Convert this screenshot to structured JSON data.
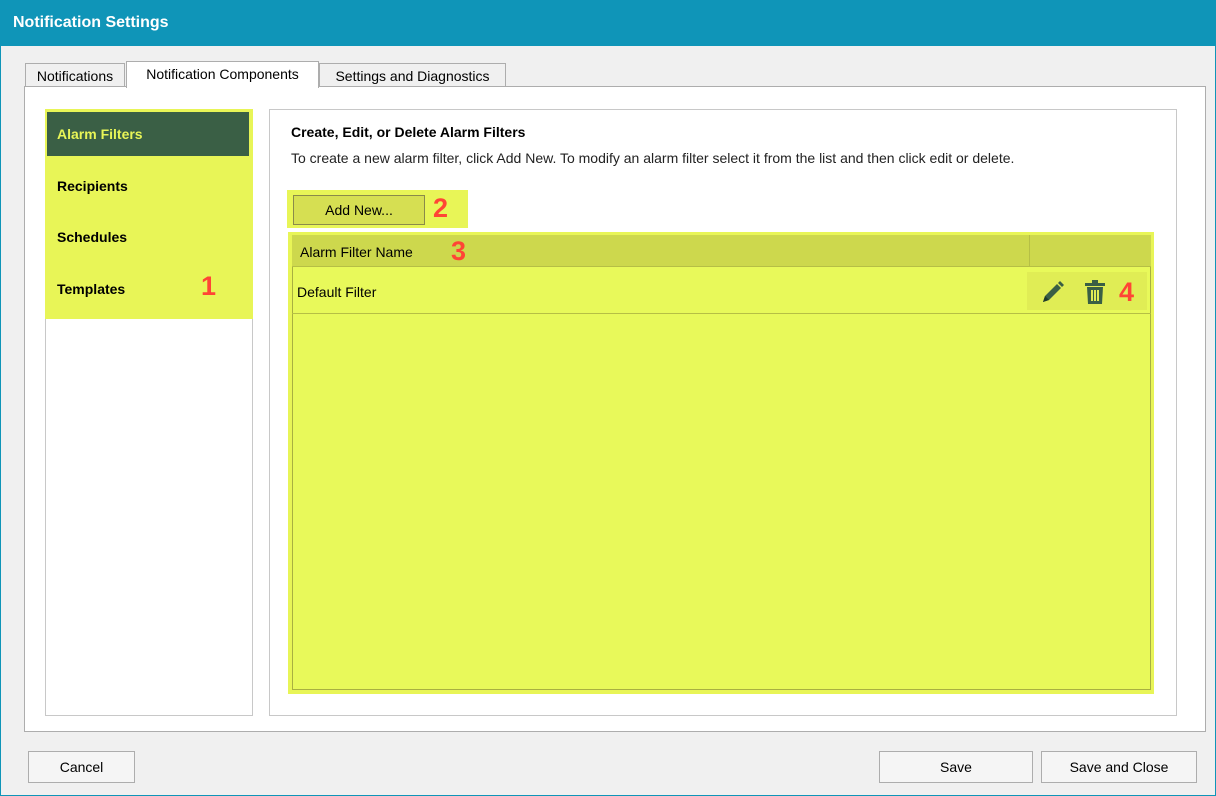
{
  "window": {
    "title": "Notification Settings"
  },
  "tabs": [
    {
      "label": "Notifications"
    },
    {
      "label": "Notification Components",
      "active": true
    },
    {
      "label": "Settings and Diagnostics"
    }
  ],
  "sidebar": {
    "items": [
      {
        "label": "Alarm Filters",
        "selected": true
      },
      {
        "label": "Recipients"
      },
      {
        "label": "Schedules"
      },
      {
        "label": "Templates"
      }
    ]
  },
  "content": {
    "heading": "Create, Edit, or Delete Alarm Filters",
    "description": "To create a new alarm filter, click Add New. To modify an alarm filter select it from the list and then click edit or delete.",
    "add_button_label": "Add New...",
    "table": {
      "columns": [
        "Alarm Filter Name"
      ],
      "rows": [
        {
          "name": "Default Filter"
        }
      ],
      "row_actions": [
        "pencil-icon",
        "trash-icon"
      ]
    }
  },
  "annotations": [
    "1",
    "2",
    "3",
    "4"
  ],
  "footer": {
    "cancel_label": "Cancel",
    "save_label": "Save",
    "save_close_label": "Save and Close"
  },
  "colors": {
    "titlebar": "#0f95b8",
    "highlight": "#e8f557",
    "selected_nav_bg": "#3a5f45",
    "annotation": "#ff4535"
  }
}
